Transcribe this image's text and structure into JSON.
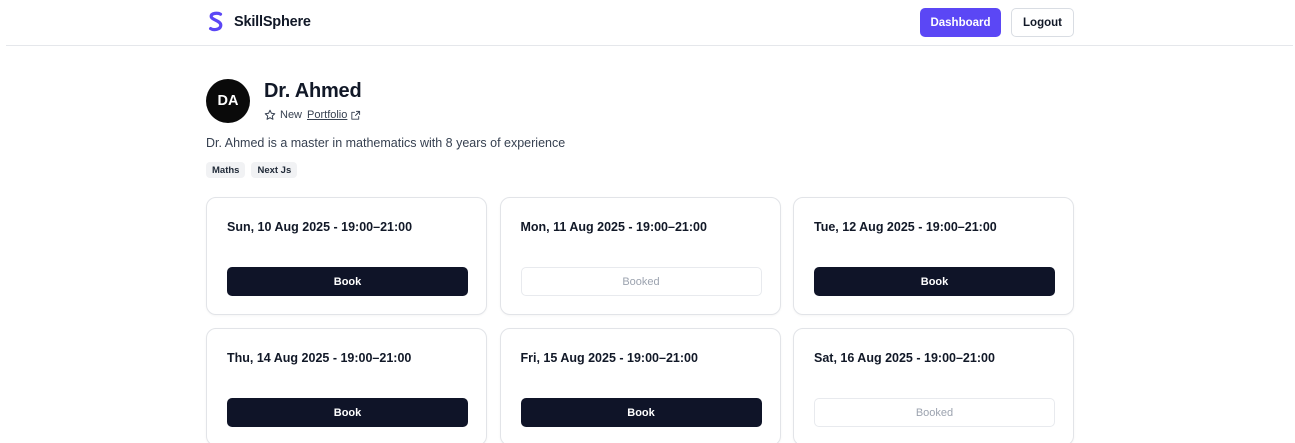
{
  "header": {
    "brand": "SkillSphere",
    "dashboard_label": "Dashboard",
    "logout_label": "Logout",
    "brand_color": "#5b47f5"
  },
  "tutor": {
    "initials": "DA",
    "name": "Dr. Ahmed",
    "status": "New",
    "portfolio_label": "Portfolio",
    "bio": "Dr. Ahmed is a master in mathematics with 8 years of experience",
    "tags": [
      "Maths",
      "Next Js"
    ]
  },
  "slots": [
    {
      "time": "Sun, 10 Aug 2025 - 19:00–21:00",
      "action": "Book",
      "state": "available"
    },
    {
      "time": "Mon, 11 Aug 2025 - 19:00–21:00",
      "action": "Booked",
      "state": "booked"
    },
    {
      "time": "Tue, 12 Aug 2025 - 19:00–21:00",
      "action": "Book",
      "state": "available"
    },
    {
      "time": "Thu, 14 Aug 2025 - 19:00–21:00",
      "action": "Book",
      "state": "available"
    },
    {
      "time": "Fri, 15 Aug 2025 - 19:00–21:00",
      "action": "Book",
      "state": "available"
    },
    {
      "time": "Sat, 16 Aug 2025 - 19:00–21:00",
      "action": "Booked",
      "state": "booked"
    }
  ],
  "icons": {
    "logo": "skillsphere-logo-icon",
    "status": "star-icon",
    "portfolio": "external-link-icon"
  }
}
